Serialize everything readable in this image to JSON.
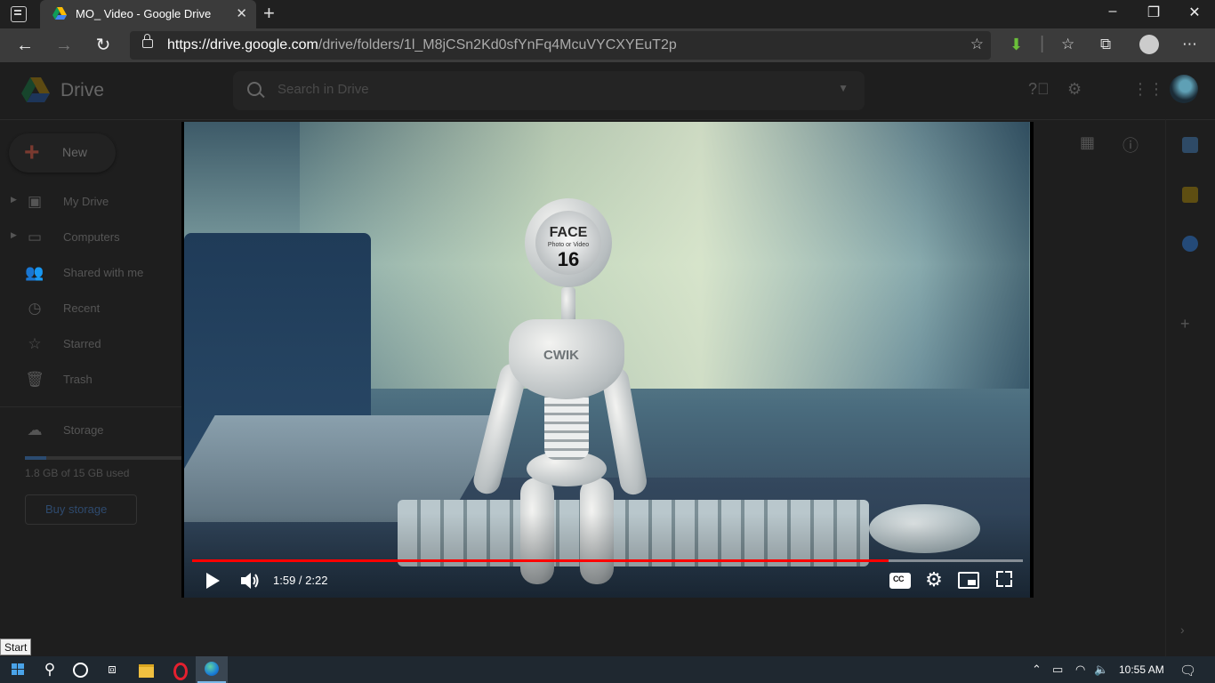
{
  "browser": {
    "tab_title": "MO_ Video - Google Drive",
    "url_host": "https://drive.google.com",
    "url_path": "/drive/folders/1l_M8jCSn2Kd0sfYnFq4McuVYCXYEuT2p",
    "window_buttons": [
      "–",
      "❐",
      "✕"
    ]
  },
  "drive": {
    "app_name": "Drive",
    "search_placeholder": "Search in Drive",
    "new_label": "New",
    "nav": [
      {
        "label": "My Drive",
        "icon": "my-drive-icon"
      },
      {
        "label": "Computers",
        "icon": "computers-icon"
      },
      {
        "label": "Shared with me",
        "icon": "shared-icon"
      },
      {
        "label": "Recent",
        "icon": "clock-icon"
      },
      {
        "label": "Starred",
        "icon": "star-icon"
      },
      {
        "label": "Trash",
        "icon": "trash-icon"
      }
    ],
    "storage_label": "Storage",
    "storage_used": "1.8 GB of 15 GB used",
    "storage_fraction": 0.12,
    "buy_storage": "Buy storage"
  },
  "video": {
    "head_text_1": "FACE",
    "head_text_2": "Photo or Video",
    "head_text_3": "16",
    "torso_text": "CWIK",
    "time": "1:59 / 2:22",
    "progress_fraction": 0.838
  },
  "tooltip": {
    "start": "Start"
  },
  "taskbar": {
    "clock": "10:55 AM"
  },
  "colors": {
    "progress": "#ff0000",
    "chrome_dark": "#202020",
    "toolbar": "#3b3b3b",
    "taskbar": "#1f2830"
  }
}
